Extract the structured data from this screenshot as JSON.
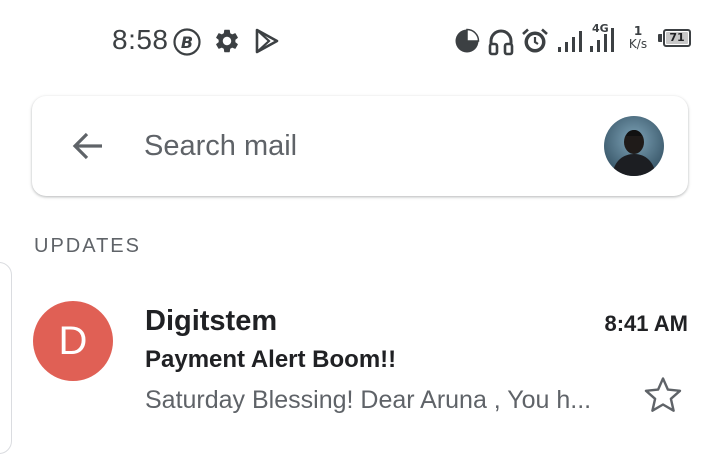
{
  "status_bar": {
    "time": "8:58",
    "net_speed_value": "1",
    "net_speed_unit": "K/s",
    "network_type": "4G",
    "battery_level": "71",
    "icons": [
      "b-circle-icon",
      "gear-icon",
      "play-store-icon",
      "data-saver-icon",
      "headphones-icon",
      "alarm-icon",
      "signal-icon",
      "signal-4g-icon",
      "battery-icon"
    ],
    "icon_color": "#3c4043"
  },
  "search": {
    "back_icon": "arrow-back-icon",
    "placeholder": "Search mail",
    "value": ""
  },
  "section": {
    "title": "UPDATES"
  },
  "emails": [
    {
      "avatar_letter": "D",
      "avatar_color": "#e06055",
      "sender": "Digitstem",
      "time": "8:41 AM",
      "subject": "Payment Alert Boom!!",
      "snippet": "Saturday Blessing! Dear Aruna , You h...",
      "starred": false
    }
  ]
}
